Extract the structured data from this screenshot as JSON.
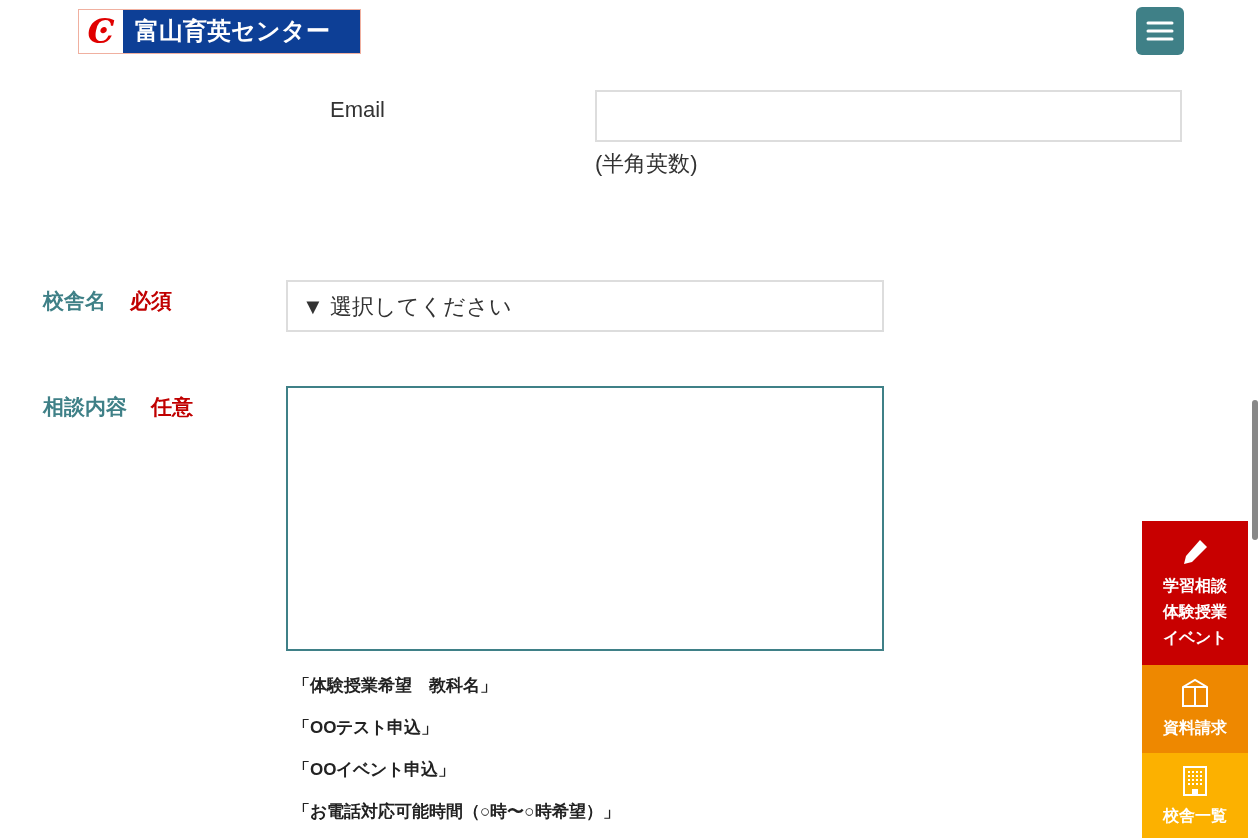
{
  "header": {
    "logo_mark": "Ͼ",
    "logo_text": "富山育英センター"
  },
  "form": {
    "email": {
      "label": "Email",
      "note": "(半角英数)"
    },
    "school": {
      "label": "校舎名",
      "badge": "必須",
      "select": "▼ 選択してください"
    },
    "consult": {
      "label": "相談内容",
      "badge": "任意",
      "hints": [
        "「体験授業希望　教科名」",
        "「OOテスト申込」",
        "「OOイベント申込」",
        "「お電話対応可能時間（○時〜○時希望）」"
      ]
    }
  },
  "side_buttons": [
    {
      "kind": "pencil",
      "color": "#c80000",
      "lines": [
        "学習相談",
        "体験授業",
        "イベント"
      ]
    },
    {
      "kind": "box",
      "color": "#ee8800",
      "lines": [
        "資料請求"
      ]
    },
    {
      "kind": "building",
      "color": "#fcb100",
      "lines": [
        "校舎一覧"
      ]
    }
  ]
}
